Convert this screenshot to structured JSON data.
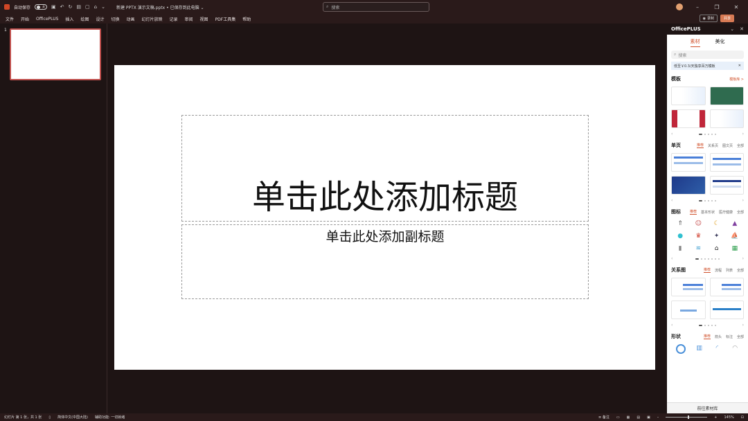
{
  "titlebar": {
    "autosave_label": "自动保存",
    "toggle_state": "关",
    "doc_title": "新建 PPTX 演示文稿.pptx • 已保存到此电脑 ⌄",
    "search_placeholder": "搜索"
  },
  "menu": {
    "items": [
      "文件",
      "开始",
      "OfficePLUS",
      "插入",
      "绘图",
      "设计",
      "切换",
      "动画",
      "幻灯片放映",
      "记录",
      "审阅",
      "视图",
      "PDF工具集",
      "帮助"
    ],
    "record_label": "录制",
    "share_label": "共享"
  },
  "thumbnails": {
    "slide_number": "1"
  },
  "slide": {
    "title_placeholder": "单击此处添加标题",
    "subtitle_placeholder": "单击此处添加副标题"
  },
  "pane": {
    "title": "OfficePLUS",
    "tabs": [
      "素材",
      "美化"
    ],
    "search_placeholder": "搜索",
    "promo_text": "低至￥0.3/天独享百万模板",
    "templates": {
      "heading": "模板",
      "link": "模板库 >"
    },
    "single_page": {
      "heading": "单页",
      "tabs": [
        "推荐",
        "关系页",
        "图文页",
        "全部"
      ]
    },
    "icons": {
      "heading": "图标",
      "tabs": [
        "推荐",
        "基本形状",
        "医疗健康",
        "全部"
      ]
    },
    "relation": {
      "heading": "关系图",
      "tabs": [
        "推荐",
        "流程",
        "列表",
        "全部"
      ]
    },
    "shapes": {
      "heading": "形状",
      "tabs": [
        "推荐",
        "箭头",
        "标注",
        "全部"
      ]
    },
    "footer_button": "前往素材库"
  },
  "status": {
    "slide_info": "幻灯片 第 1 张，共 1 张",
    "language": "简体中文(中国大陆)",
    "accessibility": "辅助功能: 一切就绪",
    "notes": "备注",
    "zoom": "145%"
  }
}
